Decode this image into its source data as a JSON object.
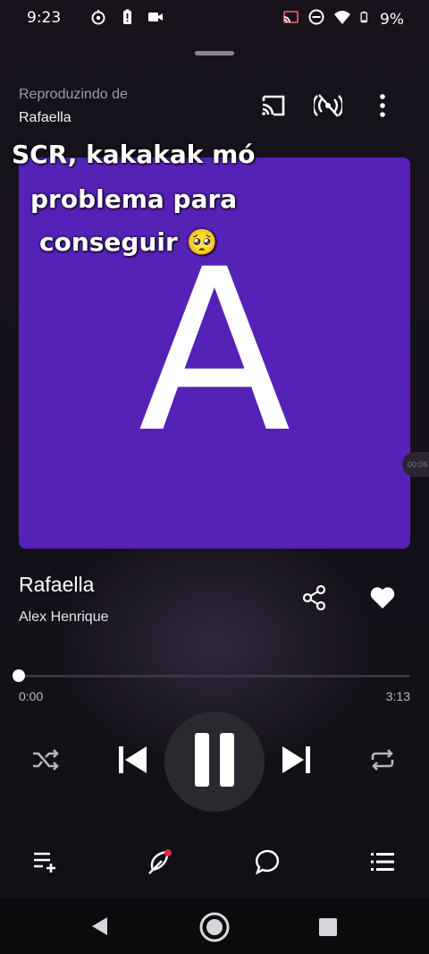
{
  "status_bar": {
    "time": "9:23",
    "battery_percent": "9%",
    "left_icons": [
      "data-saver-icon",
      "battery-alert-icon",
      "video-camera-icon"
    ],
    "right_icons": [
      "cast-active-icon",
      "do-not-disturb-icon",
      "wifi-icon",
      "battery-icon"
    ]
  },
  "header": {
    "playing_from_label": "Reproduzindo de",
    "playing_from_name": "Rafaella",
    "icons": [
      "cast-icon",
      "broadcast-off-icon",
      "more-vert-icon"
    ]
  },
  "artwork": {
    "letter": "A",
    "background_color": "#5522b8"
  },
  "caption": {
    "line1": "SCR, kakakak mó",
    "line2": "problema para",
    "line3": "conseguir 🥺"
  },
  "side_pill_text": "00:06",
  "track": {
    "title": "Rafaella",
    "artist": "Alex Henrique"
  },
  "progress": {
    "current": "0:00",
    "total": "3:13",
    "fraction": 0.0
  },
  "controls": [
    "shuffle-icon",
    "previous-icon",
    "pause-icon",
    "next-icon",
    "repeat-icon"
  ],
  "bottom_bar": [
    "queue-add-icon",
    "lyrics-icon",
    "comments-icon",
    "list-icon"
  ],
  "colors": {
    "background": "#141019",
    "accent_purple": "#5522b8",
    "notification_dot": "#e2283a"
  }
}
